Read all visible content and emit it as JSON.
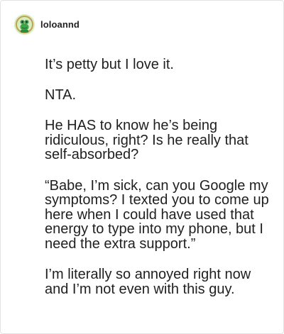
{
  "post": {
    "author": {
      "username": "loloannd",
      "avatar_icon": "frog-avatar-icon"
    },
    "paragraphs": [
      "It’s petty but I love it.",
      "NTA.",
      "He HAS to know he’s being ridiculous, right? Is he really that self-absorbed?",
      "“Babe, I’m sick, can you Google my symptoms? I texted you to come up here when I could have used that energy to type into my phone, but I need the extra support.”",
      "I’m literally so annoyed right now and I’m not even with this guy."
    ]
  },
  "colors": {
    "text": "#1f1f1f",
    "username": "#222222",
    "card_border": "#e3e3e3",
    "background": "#ffffff"
  }
}
